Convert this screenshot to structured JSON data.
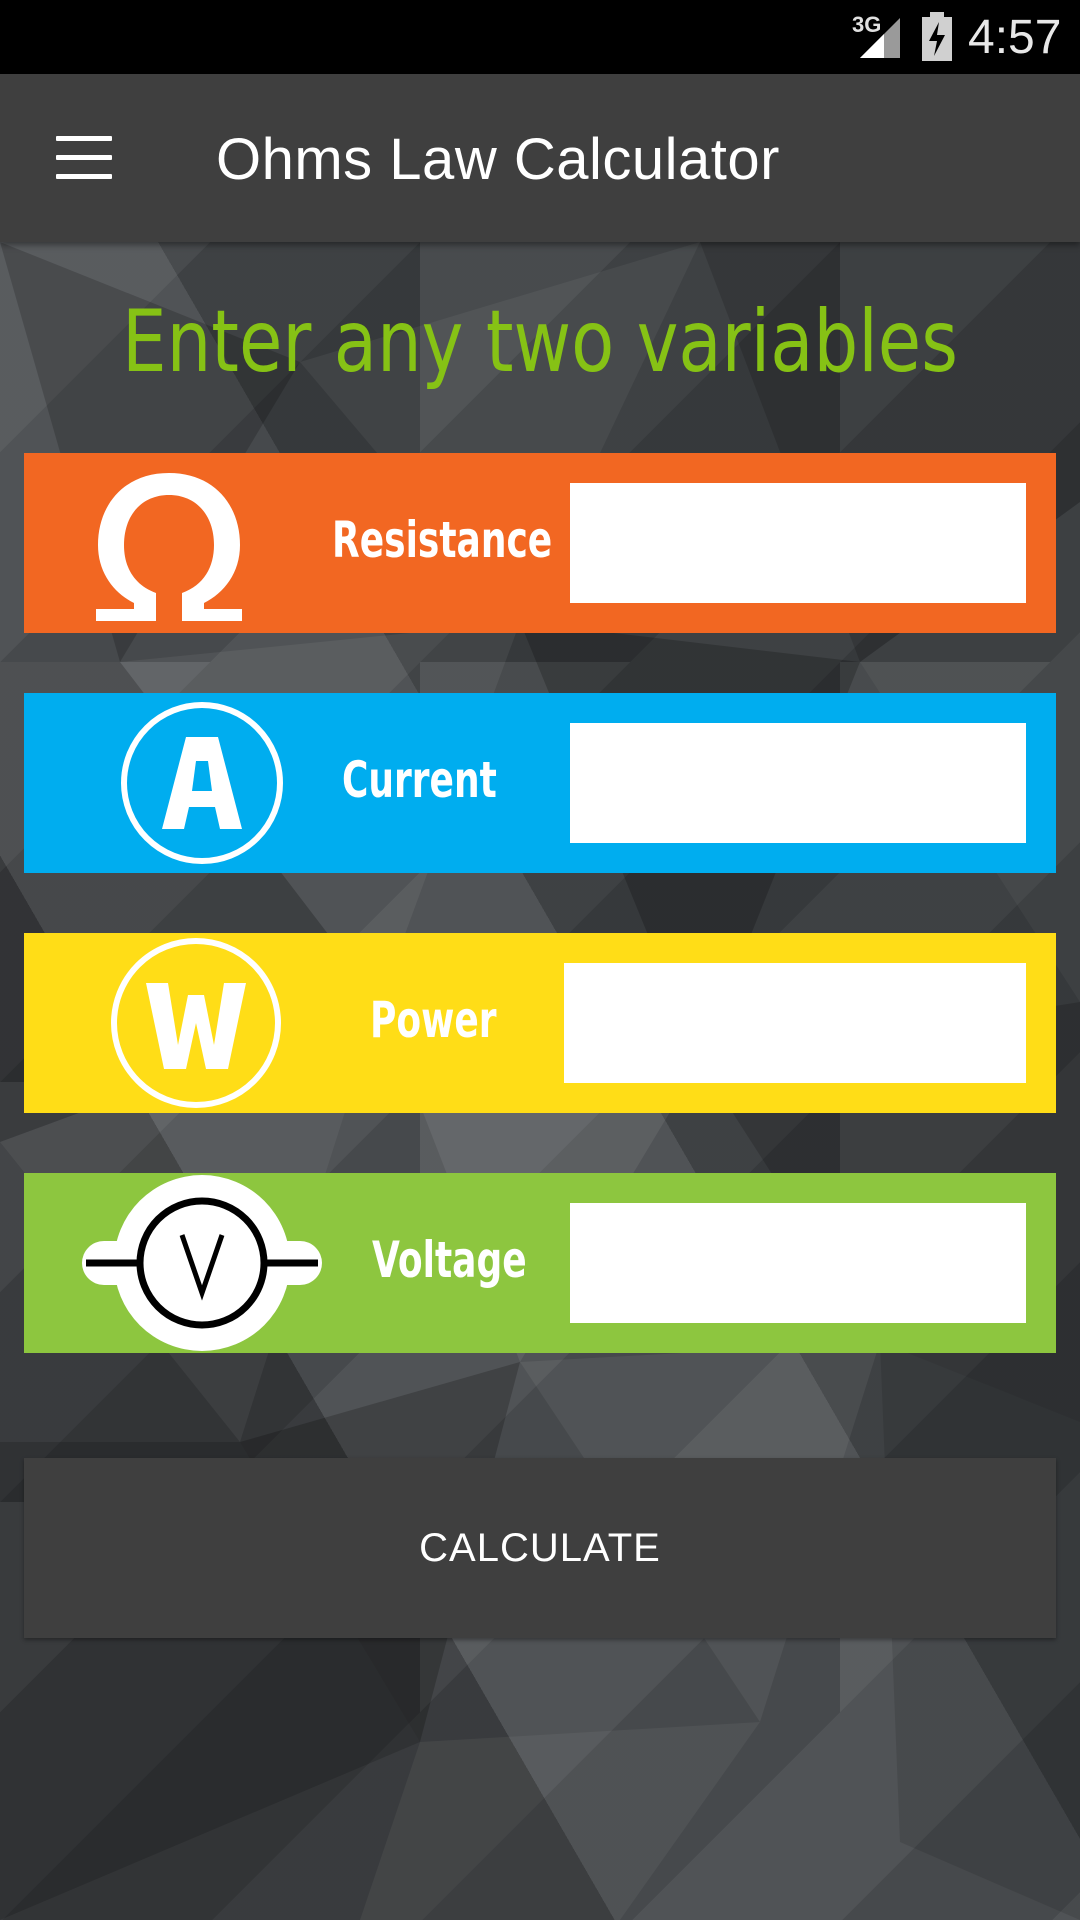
{
  "status_bar": {
    "network": "3G",
    "time": "4:57"
  },
  "app_bar": {
    "menu_icon": "hamburger-menu-icon",
    "title": "Ohms Law Calculator"
  },
  "headline": "Enter any two variables",
  "rows": [
    {
      "icon": "omega-icon",
      "label": "Resistance",
      "color": "#f26722",
      "value": ""
    },
    {
      "icon": "ampere-icon",
      "label": "Current",
      "color": "#00adef",
      "value": ""
    },
    {
      "icon": "watt-icon",
      "label": "Power",
      "color": "#ffdd17",
      "value": ""
    },
    {
      "icon": "voltmeter-icon",
      "label": "Voltage",
      "color": "#8dc63f",
      "value": ""
    }
  ],
  "calculate_label": "CALCULATE",
  "colors": {
    "headline": "#86c215",
    "app_bar": "#3f3f3f",
    "button": "#3f3f3f"
  }
}
